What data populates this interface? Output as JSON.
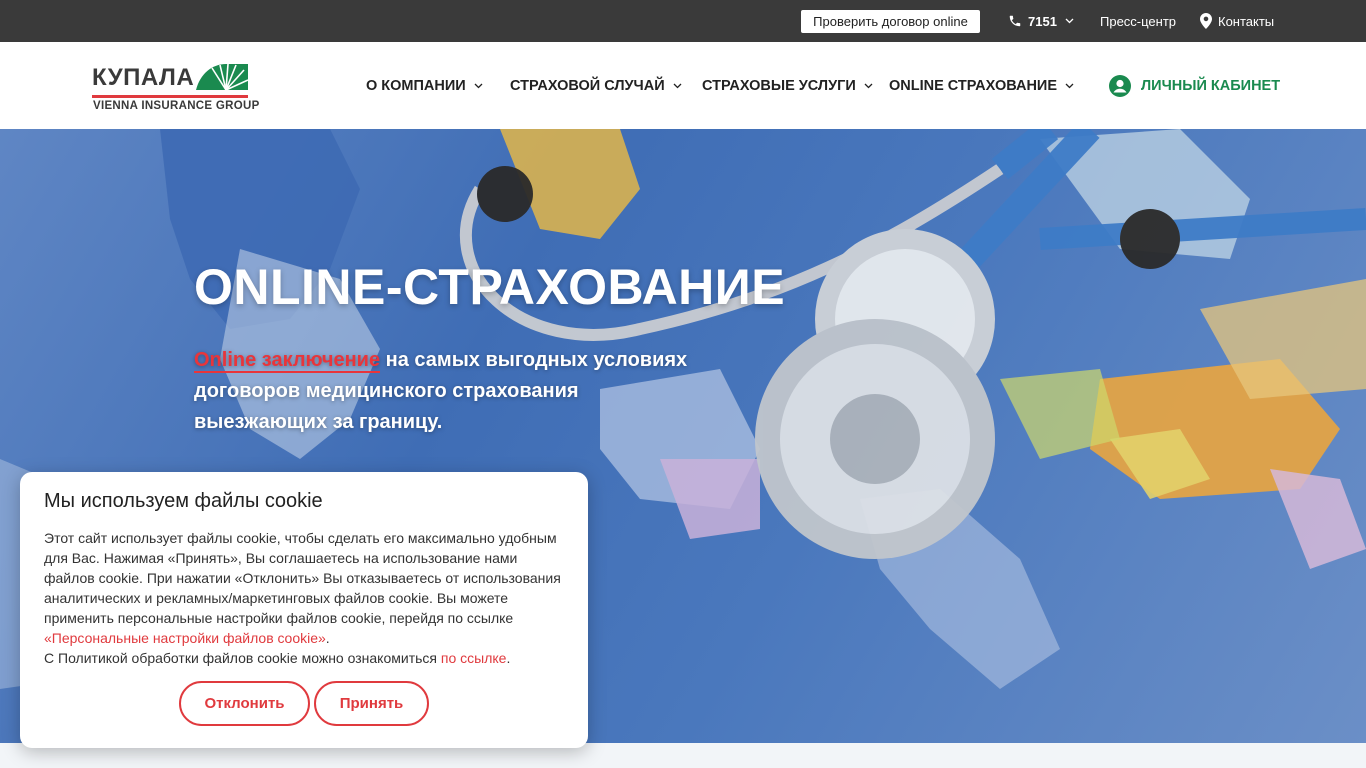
{
  "topbar": {
    "check_contract": "Проверить договор online",
    "phone": "7151",
    "press": "Пресс-центр",
    "contacts": "Контакты"
  },
  "logo": {
    "name": "КУПАЛА",
    "subtitle": "VIENNA INSURANCE GROUP"
  },
  "nav": {
    "items": [
      {
        "label": "О КОМПАНИИ"
      },
      {
        "label": "СТРАХОВОЙ СЛУЧАЙ"
      },
      {
        "label": "СТРАХОВЫЕ УСЛУГИ"
      },
      {
        "label": "ONLINE СТРАХОВАНИЕ"
      }
    ],
    "cabinet": "ЛИЧНЫЙ КАБИНЕТ"
  },
  "hero": {
    "title": "ONLINE-СТРАХОВАНИЕ",
    "highlight": "Online заключение",
    "text_line1": " на самых выгодных условиях",
    "text_line2": "договоров медицинского страхования",
    "text_line3": "выезжающих за границу."
  },
  "cookie": {
    "title": "Мы используем файлы cookie",
    "text1": "Этот сайт использует файлы cookie, чтобы сделать его максимально удобным для Вас. Нажимая «Принять», Вы соглашаетесь на использование нами файлов cookie. При нажатии «Отклонить» Вы отказываетесь от использования аналитических и рекламных/маркетинговых файлов cookie. Вы можете применить персональные настройки файлов cookie, перейдя по ссылке ",
    "link1": "«Персональные настройки файлов cookie»",
    "text2": ".",
    "text3": "С Политикой обработки файлов cookie можно ознакомиться ",
    "link2": "по ссылке",
    "text4": ".",
    "decline": "Отклонить",
    "accept": "Принять"
  },
  "colors": {
    "topbar": "#3a3a3a",
    "accent_red": "#e03a3e",
    "accent_green": "#1a8a4f"
  },
  "icons": [
    "phone-icon",
    "chevron-down-icon",
    "location-pin-icon",
    "user-circle-icon",
    "logo-fan-icon"
  ]
}
